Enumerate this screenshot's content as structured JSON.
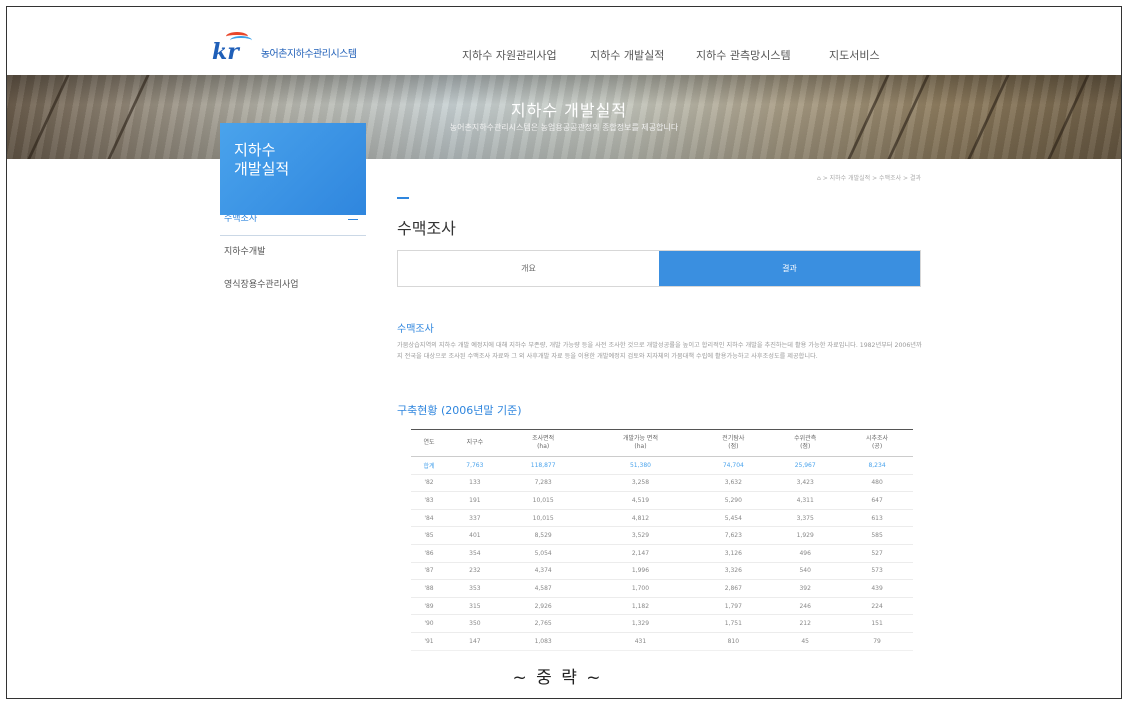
{
  "header": {
    "logo_mark": "kr",
    "logo_text": "농어촌지하수관리시스템",
    "nav": [
      "지하수 자원관리사업",
      "지하수 개발실적",
      "지하수 관측망시스템",
      "지도서비스"
    ]
  },
  "banner": {
    "title": "지하수 개발실적",
    "subtitle": "농어촌지하수관리시스템은 농업용공공관정의 종합정보를 제공합니다"
  },
  "sidebar": {
    "title_line1": "지하수",
    "title_line2": "개발실적",
    "items": [
      {
        "label": "수맥조사",
        "active": true
      },
      {
        "label": "지하수개발",
        "active": false
      },
      {
        "label": "영식장용수관리사업",
        "active": false
      }
    ]
  },
  "breadcrumb": "⌂ > 지하수 개발실적 > 수맥조사 > 결과",
  "main": {
    "page_title": "수맥조사",
    "tabs": [
      {
        "label": "개요",
        "active": false
      },
      {
        "label": "결과",
        "active": true
      }
    ],
    "section_title": "수맥조사",
    "description": "가뭄상습지역의 지하수 개발 예정지에 대해 지하수 부존량, 개발 가능량 등을 사전 조사한 것으로 개발성공률을 높이고 합리적인 지하수 개발을 추진하는데 활용 가능한 자료입니다. 1982년부터 2006년까지 전국을 대상으로 조사된 수맥조사 자료와 그 외 사후개발 자료 등을 이용한 개발예정지 검토와 지자체의 가뭄대책 수립에 활용가능하고 사후조성도를 제공합니다.",
    "table_title": "구축현황 (2006년말 기준)",
    "table": {
      "headers": [
        "연도",
        "지구수",
        "조사면적\n(ha)",
        "개발가능 면적\n(ha)",
        "전기탐사\n(점)",
        "수위관측\n(점)",
        "시추조사\n(공)"
      ],
      "sum_row": [
        "합계",
        "7,763",
        "118,877",
        "51,380",
        "74,704",
        "25,967",
        "8,234"
      ],
      "rows": [
        [
          "'82",
          "133",
          "7,283",
          "3,258",
          "3,632",
          "3,423",
          "480"
        ],
        [
          "'83",
          "191",
          "10,015",
          "4,519",
          "5,290",
          "4,311",
          "647"
        ],
        [
          "'84",
          "337",
          "10,015",
          "4,812",
          "5,454",
          "3,375",
          "613"
        ],
        [
          "'85",
          "401",
          "8,529",
          "3,529",
          "7,623",
          "1,929",
          "585"
        ],
        [
          "'86",
          "354",
          "5,054",
          "2,147",
          "3,126",
          "496",
          "527"
        ],
        [
          "'87",
          "232",
          "4,374",
          "1,996",
          "3,326",
          "540",
          "573"
        ],
        [
          "'88",
          "353",
          "4,587",
          "1,700",
          "2,867",
          "392",
          "439"
        ],
        [
          "'89",
          "315",
          "2,926",
          "1,182",
          "1,797",
          "246",
          "224"
        ],
        [
          "'90",
          "350",
          "2,765",
          "1,329",
          "1,751",
          "212",
          "151"
        ],
        [
          "'91",
          "147",
          "1,083",
          "431",
          "810",
          "45",
          "79"
        ]
      ]
    }
  },
  "ellipsis": "~ 중   략 ~",
  "colors": {
    "accent": "#2f86de",
    "tab_active": "#3a8fe0"
  }
}
